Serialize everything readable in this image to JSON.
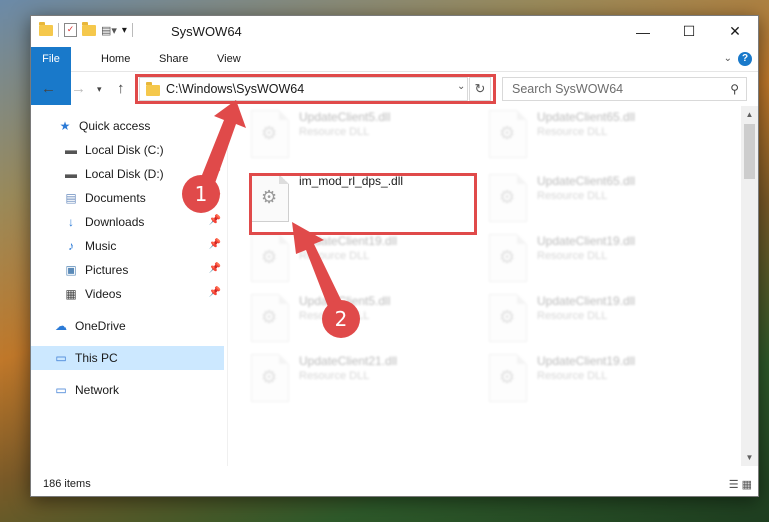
{
  "window": {
    "title": "SysWOW64",
    "minimize": "—",
    "maximize": "☐",
    "close": "✕"
  },
  "ribbon": {
    "tabs": [
      "File",
      "Home",
      "Share",
      "View"
    ],
    "help": "?"
  },
  "nav": {
    "address": "C:\\Windows\\SysWOW64",
    "search_placeholder": "Search SysWOW64"
  },
  "sidebar": {
    "items": [
      {
        "label": "Quick access",
        "icon": "star-icon"
      },
      {
        "label": "Local Disk (C:)",
        "icon": "drive-icon"
      },
      {
        "label": "Local Disk (D:)",
        "icon": "drive-icon"
      },
      {
        "label": "Documents",
        "icon": "documents-icon"
      },
      {
        "label": "Downloads",
        "icon": "download-arrow-icon"
      },
      {
        "label": "Music",
        "icon": "music-note-icon"
      },
      {
        "label": "Pictures",
        "icon": "pictures-icon"
      },
      {
        "label": "Videos",
        "icon": "film-icon"
      },
      {
        "label": "OneDrive",
        "icon": "cloud-icon"
      },
      {
        "label": "This PC",
        "icon": "monitor-icon"
      },
      {
        "label": "Network",
        "icon": "network-icon"
      }
    ]
  },
  "files": [
    {
      "name": "UpdateClient5.dll",
      "type": "Resource DLL"
    },
    {
      "name": "UpdateClient65.dll",
      "type": "Resource DLL"
    },
    {
      "name": "im_mod_rl_dps_.dll",
      "type": ""
    },
    {
      "name": "UpdateClient65.dll",
      "type": "Resource DLL"
    },
    {
      "name": "UpdateClient19.dll",
      "type": "Resource DLL"
    },
    {
      "name": "UpdateClient19.dll",
      "type": "Resource DLL"
    },
    {
      "name": "UpdateClient5.dll",
      "type": "Resource DLL"
    },
    {
      "name": "UpdateClient19.dll",
      "type": "Resource DLL"
    },
    {
      "name": "UpdateClient21.dll",
      "type": "Resource DLL"
    },
    {
      "name": "UpdateClient19.dll",
      "type": "Resource DLL"
    }
  ],
  "status": {
    "count": "186 items"
  },
  "annotations": {
    "step1": "1",
    "step2": "2"
  },
  "colors": {
    "accent": "#1979ca",
    "highlight": "#e04a4a"
  }
}
